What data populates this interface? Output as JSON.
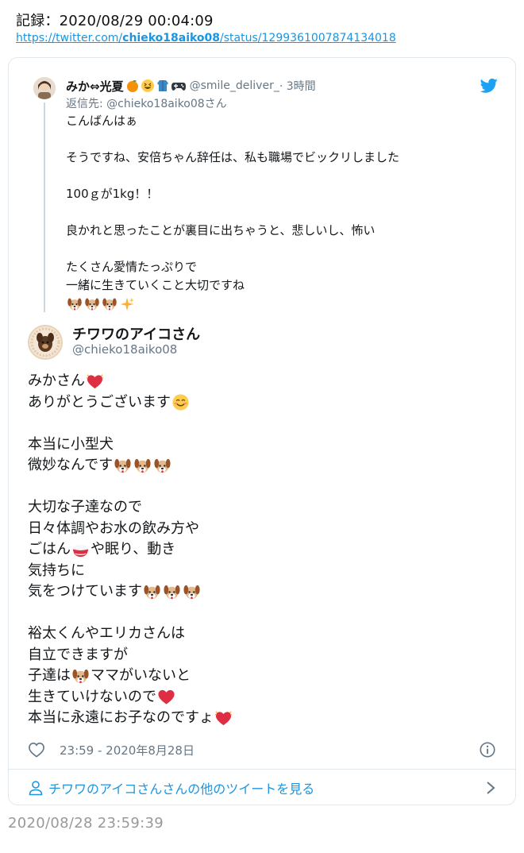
{
  "record": {
    "label": "記録：2020/08/29 00:04:09",
    "url_prefix": "https://twitter.com/",
    "url_user": "chieko18aiko08",
    "url_suffix": "/status/1299361007874134018"
  },
  "parent_tweet": {
    "name": "みか⇔光夏",
    "name_emojis": [
      "orange-emoji",
      "grinning-emoji",
      "jacket-emoji",
      "game-controller-emoji"
    ],
    "handle": "@smile_deliver_",
    "time": "· 3時間",
    "reply_to": "返信先: @chieko18aiko08さん",
    "lines": [
      "こんばんはぁ",
      "",
      "そうですね、安倍ちゃん辞任は、私も職場でビックリしました",
      "",
      "100ｇが1kg！！",
      "",
      "良かれと思ったことが裏目に出ちゃうと、悲しいし、怖い",
      "",
      "たくさん愛情たっぷりで",
      "一緒に生きていくこと大切ですね"
    ],
    "last_line_emojis": [
      "dog-face-emoji",
      "dog-face-emoji",
      "dog-face-emoji",
      "sparkles-emoji"
    ]
  },
  "main_tweet": {
    "name": "チワワのアイコさん",
    "handle": "@chieko18aiko08",
    "lines": [
      {
        "text": "みかさん",
        "emojis": [
          "beating-heart-emoji"
        ]
      },
      {
        "text": "ありがとうございます",
        "emojis": [
          "smiling-face-emoji"
        ]
      },
      {
        "text": "",
        "emojis": []
      },
      {
        "text": "本当に小型犬",
        "emojis": []
      },
      {
        "text": "微妙なんです",
        "emojis": [
          "dog-face-emoji",
          "dog-face-emoji",
          "dog-face-emoji"
        ]
      },
      {
        "text": "",
        "emojis": []
      },
      {
        "text": "大切な子達なので",
        "emojis": []
      },
      {
        "text": "日々体調やお水の飲み方や",
        "emojis": []
      },
      {
        "text": "ごはん",
        "emojis": [
          "rice-bowl-emoji"
        ],
        "after": "や眠り、動き"
      },
      {
        "text": "気持ちに",
        "emojis": []
      },
      {
        "text": "気をつけています",
        "emojis": [
          "dog-face-emoji",
          "dog-face-emoji",
          "dog-face-emoji"
        ]
      },
      {
        "text": "",
        "emojis": []
      },
      {
        "text": "裕太くんやエリカさんは",
        "emojis": []
      },
      {
        "text": "自立できますが",
        "emojis": []
      },
      {
        "text": "子達は",
        "emojis": [
          "dog-face-emoji"
        ],
        "after": "ママがいないと"
      },
      {
        "text": "生きていけないので",
        "emojis": [
          "red-heart-emoji"
        ]
      },
      {
        "text": "本当に永遠にお子なのですょ",
        "emojis": [
          "beating-heart-emoji"
        ]
      }
    ],
    "timestamp": "23:59 - 2020年8月28日",
    "more_link": "チワワのアイコさんさんの他のツイートを見る"
  },
  "footer": {
    "time": "2020/08/28 23:59:39"
  },
  "colors": {
    "link": "#1b95e0",
    "secondary_text": "#657786",
    "border": "#e1e8ed",
    "heart_red": "#e0245e"
  }
}
